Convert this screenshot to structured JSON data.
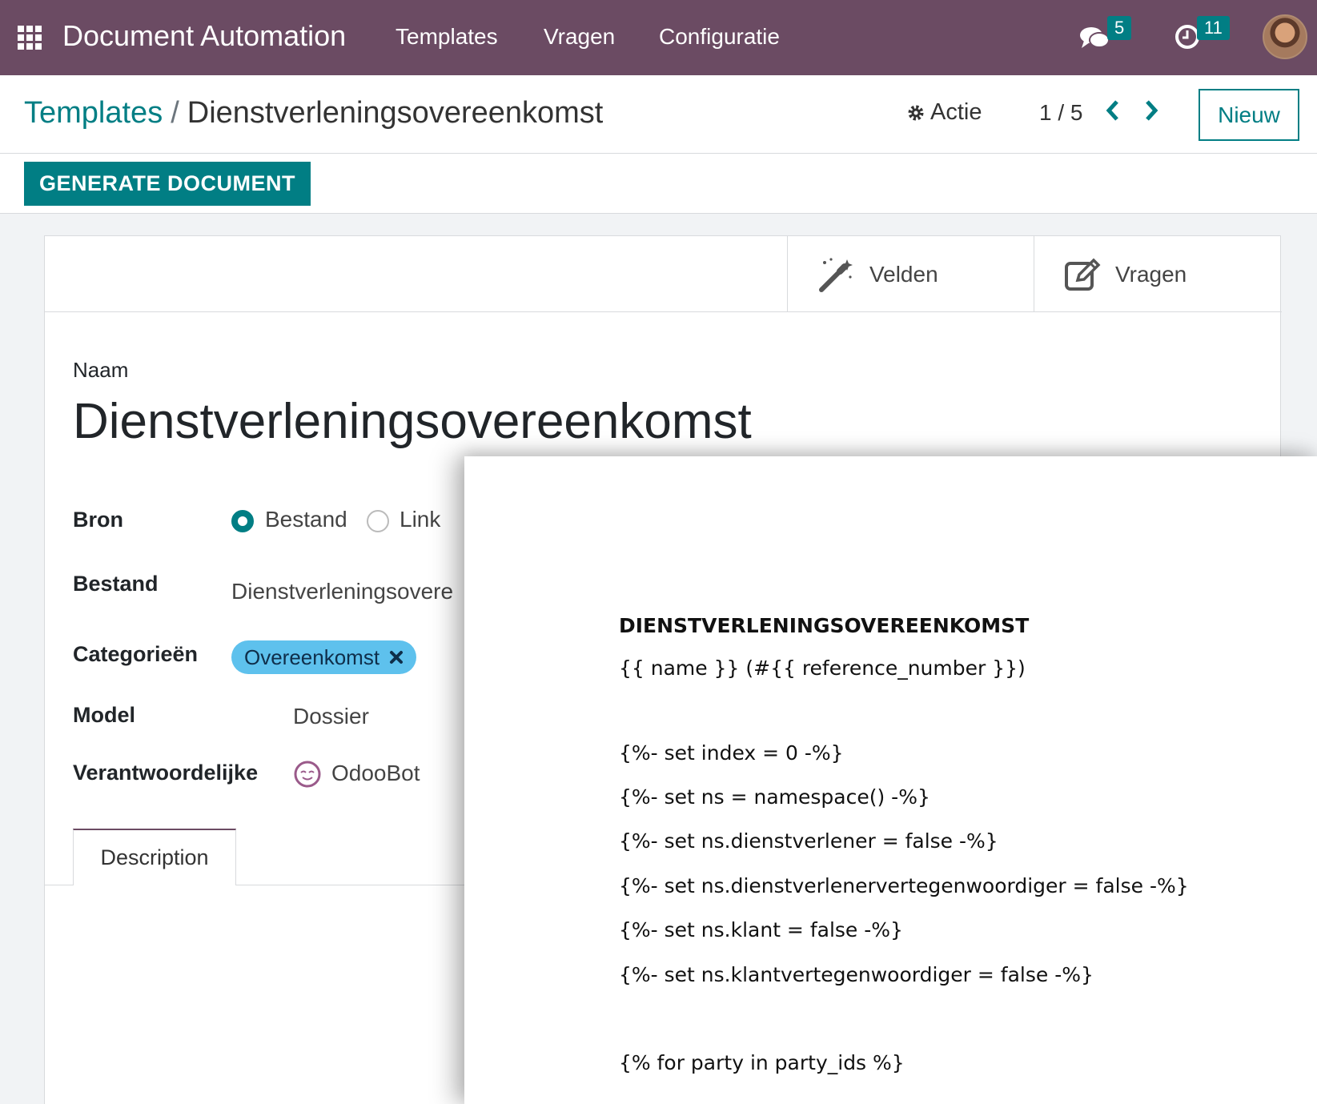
{
  "navbar": {
    "app_name": "Document Automation",
    "menu": [
      "Templates",
      "Vragen",
      "Configuratie"
    ],
    "messages_count": "5",
    "activities_count": "11"
  },
  "breadcrumb": {
    "parent": "Templates",
    "separator": "/",
    "current": "Dienstverleningsovereenkomst"
  },
  "actions": {
    "actie_label": "Actie",
    "pager": "1 / 5",
    "new_label": "Nieuw",
    "generate_label": "GENERATE DOCUMENT"
  },
  "smart_buttons": {
    "fields_label": "Velden",
    "questions_label": "Vragen"
  },
  "form": {
    "name_label": "Naam",
    "name_value": "Dienstverleningsovereenkomst",
    "source_label": "Bron",
    "source_options": [
      "Bestand",
      "Link"
    ],
    "source_selected": "Bestand",
    "file_label": "Bestand",
    "file_value": "Dienstverleningsovere",
    "categories_label": "Categorieën",
    "category_tag": "Overeenkomst",
    "model_label": "Model",
    "model_value": "Dossier",
    "responsible_label": "Verantwoordelijke",
    "responsible_value": "OdooBot",
    "tab_description": "Description"
  },
  "document_preview": {
    "lines": [
      "DIENSTVERLENINGSOVEREENKOMST",
      "{{ name }} (#{{ reference_number }})",
      "{%- set index = 0 -%}",
      "{%- set ns = namespace() -%}",
      "{%- set ns.dienstverlener = false -%}",
      "{%- set ns.dienstverlenervertegenwoordiger = false -%}",
      "{%- set ns.klant = false -%}",
      "{%- set ns.klantvertegenwoordiger = false -%}",
      "{% for party in party_ids %}"
    ]
  },
  "colors": {
    "navbar": "#6b4b63",
    "primary": "#017e84",
    "tag": "#5ec1ed"
  }
}
